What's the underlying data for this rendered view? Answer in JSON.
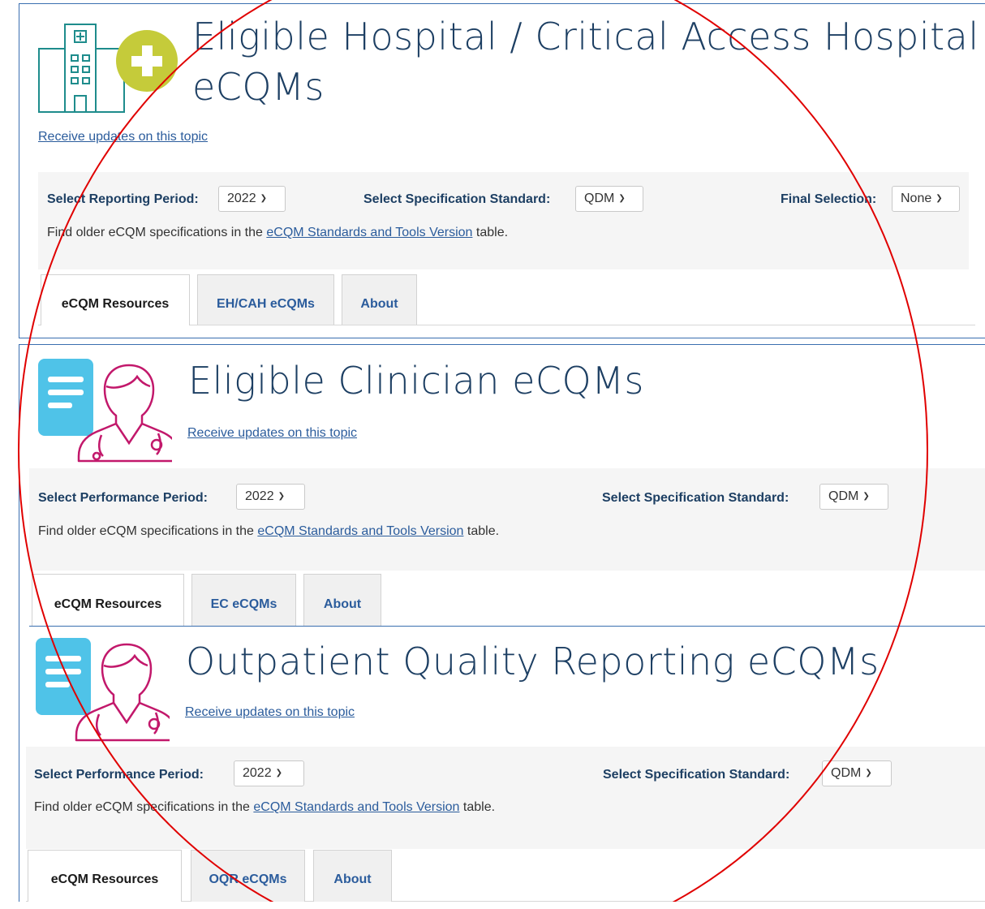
{
  "sections": [
    {
      "title_line1": "Eligible Hospital / Critical Access Hospital",
      "title_line2": "eCQMs",
      "receive_link": "Receive updates on this topic",
      "period_label": "Select Reporting Period:",
      "period_value": "2022",
      "spec_label": "Select Specification Standard:",
      "spec_value": "QDM",
      "final_label": "Final Selection:",
      "final_value": "None",
      "note_prefix": "Find older eCQM specifications in the",
      "note_link": "eCQM Standards and Tools Version",
      "note_suffix": "table.",
      "tabs": [
        "eCQM Resources",
        "EH/CAH eCQMs",
        "About"
      ]
    },
    {
      "title_line1": "Eligible Clinician eCQMs",
      "receive_link": "Receive updates on this topic",
      "period_label": "Select Performance Period:",
      "period_value": "2022",
      "spec_label": "Select Specification Standard:",
      "spec_value": "QDM",
      "note_prefix": "Find older eCQM specifications in the",
      "note_link": "eCQM Standards and Tools Version",
      "note_suffix": "table.",
      "tabs": [
        "eCQM Resources",
        "EC eCQMs",
        "About"
      ]
    },
    {
      "title_line1": "Outpatient Quality Reporting eCQMs",
      "receive_link": "Receive updates on this topic",
      "period_label": "Select Performance Period:",
      "period_value": "2022",
      "spec_label": "Select Specification Standard:",
      "spec_value": "QDM",
      "note_prefix": "Find older eCQM specifications in the",
      "note_link": "eCQM Standards and Tools Version",
      "note_suffix": "table.",
      "tabs": [
        "eCQM Resources",
        "OQR eCQMs",
        "About"
      ]
    }
  ],
  "icons": [
    "hospital-plus-icon",
    "clinician-document-icon",
    "clinician-document-icon"
  ],
  "colors": {
    "title": "#1d3f63",
    "link": "#2b5c9c",
    "annotation": "#e00000",
    "hospital_teal": "#1e8c8c",
    "plus_green": "#c5cb3a",
    "doc_blue": "#4fc3e8",
    "clinician_magenta": "#c2186b"
  }
}
